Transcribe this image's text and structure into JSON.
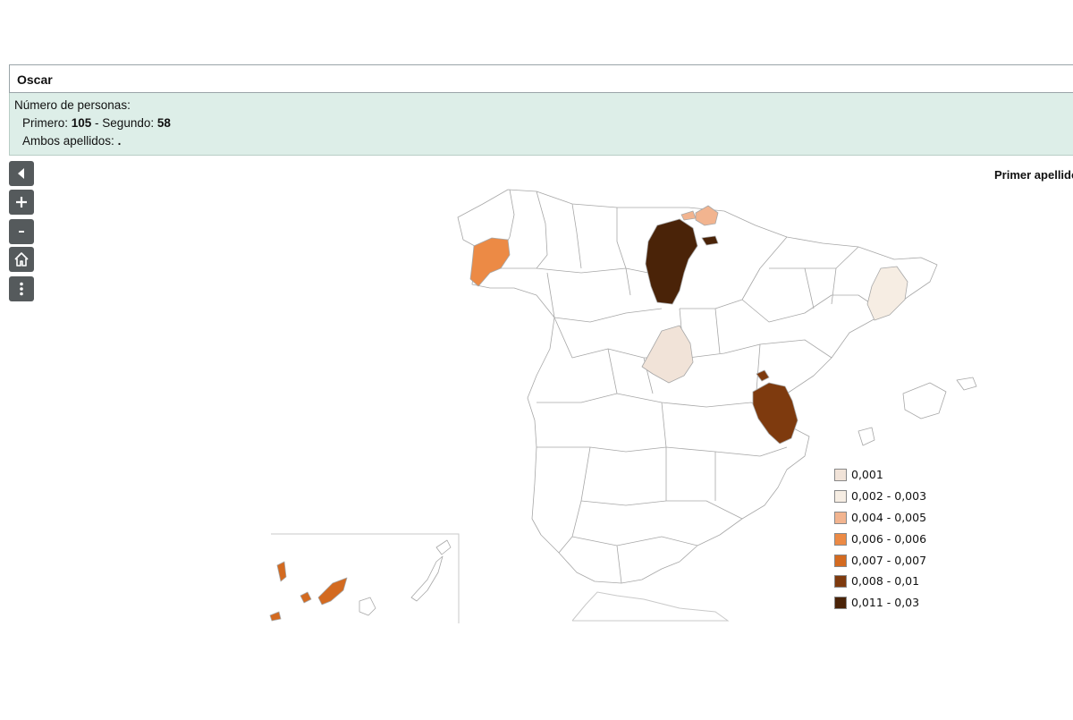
{
  "header": {
    "name": "Oscar"
  },
  "info": {
    "personas_label": "Número de personas:",
    "primero_label": "Primero: ",
    "primero_value": "105",
    "segundo_label": " - Segundo: ",
    "segundo_value": "58",
    "ambos_label": "Ambos apellidos: ",
    "ambos_value": "."
  },
  "map": {
    "title": "Primer apellido",
    "controls": [
      "back-icon",
      "zoom-in-icon",
      "zoom-out-icon",
      "home-icon",
      "more-options-icon"
    ],
    "legend": [
      {
        "label": "0,001",
        "color": "#f1e3d8"
      },
      {
        "label": "0,002 - 0,003",
        "color": "#f6ede3"
      },
      {
        "label": "0,004 - 0,005",
        "color": "#f2b48f"
      },
      {
        "label": "0,006 - 0,006",
        "color": "#ec8a45"
      },
      {
        "label": "0,007 - 0,007",
        "color": "#d36a20"
      },
      {
        "label": "0,008 - 0,01",
        "color": "#7e3a0e"
      },
      {
        "label": "0,011 - 0,03",
        "color": "#4a2308"
      }
    ],
    "highlighted_regions": [
      {
        "region": "Burgos",
        "class": "0,011 - 0,03"
      },
      {
        "region": "Valencia",
        "class": "0,008 - 0,01"
      },
      {
        "region": "Pontevedra",
        "class": "0,006 - 0,006"
      },
      {
        "region": "Gipuzkoa",
        "class": "0,004 - 0,005"
      },
      {
        "region": "Madrid",
        "class": "0,001"
      },
      {
        "region": "Barcelona",
        "class": "0,002 - 0,003"
      },
      {
        "region": "Santa Cruz de Tenerife",
        "class": "0,007 - 0,007"
      }
    ]
  }
}
